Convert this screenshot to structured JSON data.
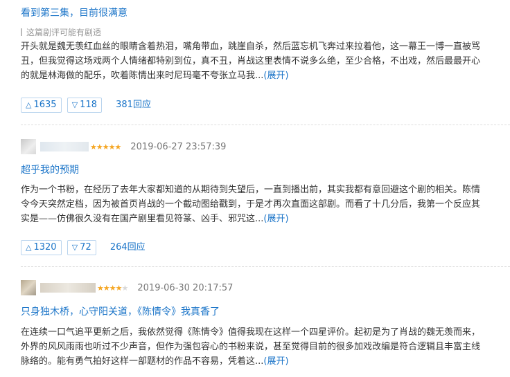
{
  "reviews": [
    {
      "title": "看到第三集，目前很满意",
      "spoiler": "这篇剧评可能有剧透",
      "lines": [
        "开头就是魏无羡红血丝的眼睛含着热泪，嘴角带血，跳崖自杀，然后蓝忘机飞奔过来拉着他，这一幕王一博一直被骂",
        "丑，但我觉得这场戏两个人情绪都特别到位，真不丑，肖战这里表情不说多么绝，至少合格，不出戏，然后最最开心",
        "的就是林海做的配乐，吹着陈情出来时尼玛毫不夸张立马我..."
      ],
      "expand": "(展开)",
      "up": "1635",
      "down": "118",
      "replies": "381回应"
    },
    {
      "rating": 5,
      "date": "2019-06-27 23:57:39",
      "title": "超乎我的预期",
      "lines": [
        "作为一个书粉，在经历了去年大家都知道的从期待到失望后，一直到播出前，其实我都有意回避这个剧的相关。陈情",
        "令今天突然定档，因为被首页肖战的一个截动图给戳到，于是才再次直面这部剧。而看了十几分后，我第一个反应其",
        "实是——仿佛很久没有在国产剧里看见符篆、凶手、邪咒这..."
      ],
      "expand": "(展开)",
      "up": "1320",
      "down": "72",
      "replies": "264回应"
    },
    {
      "rating": 4,
      "date": "2019-06-30 20:17:57",
      "title": "只身独木桥，心守阳关道，《陈情令》我真香了",
      "lines": [
        "在连续一口气追平更新之后，我依然觉得《陈情令》值得我现在这样一个四星评价。起初是为了肖战的魏无羡而来，",
        "外界的风风雨雨也听过不少声音，但作为强包容心的书粉来说，甚至觉得目前的很多加戏改编是符合逻辑且丰富主线",
        "脉络的。能有勇气拍好这样一部题材的作品不容易，凭着这..."
      ],
      "expand": "(展开)"
    }
  ],
  "icons": {
    "up": "triangle-up",
    "down": "triangle-down",
    "star": "star"
  },
  "colors": {
    "link": "#1a74c8",
    "star": "#f5a623",
    "star_off": "#d8d8d8"
  }
}
